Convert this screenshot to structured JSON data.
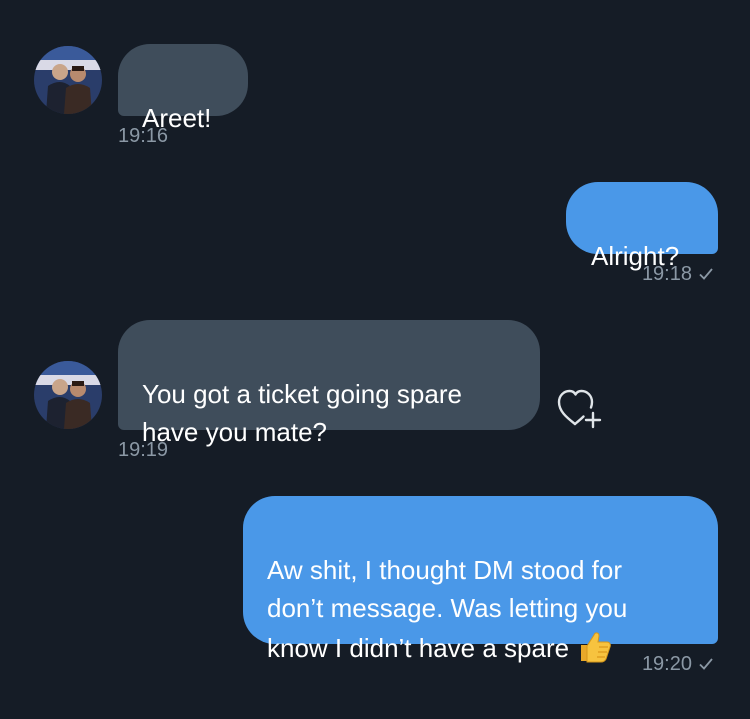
{
  "messages": [
    {
      "direction": "incoming",
      "text": "Areet!",
      "time": "19:16"
    },
    {
      "direction": "outgoing",
      "text": "Alright?",
      "time": "19:18"
    },
    {
      "direction": "incoming",
      "text": "You got a ticket going spare\nhave you mate?",
      "time": "19:19"
    },
    {
      "direction": "outgoing",
      "text": "Aw shit, I thought DM stood for\ndon’t message. Was letting you\nknow I didn’t have a spare",
      "emoji": "thumbs-up-emoji",
      "time": "19:20"
    }
  ],
  "icons": {
    "read_receipt": "checkmark-icon",
    "react": "heart-plus-icon",
    "avatar": "contact-avatar"
  },
  "colors": {
    "background": "#151c26",
    "incoming_bubble": "#3f4d5b",
    "outgoing_bubble": "#4a98e8",
    "timestamp": "#8b98a5"
  }
}
